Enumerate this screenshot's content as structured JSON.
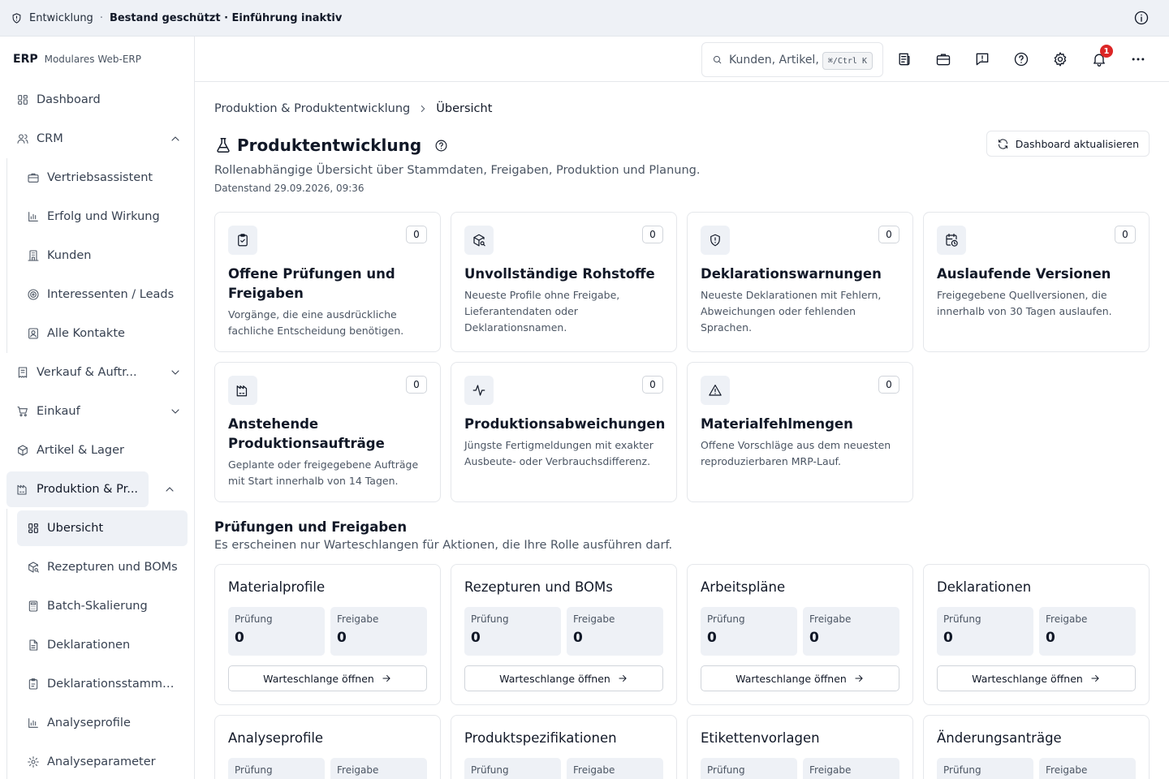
{
  "topbar": {
    "environment": "Entwicklung",
    "separator": "·",
    "status": "Bestand geschützt · Einführung inaktiv"
  },
  "brand": {
    "name": "ERP",
    "subtitle": "Modulares Web-ERP"
  },
  "sidebar": {
    "items": [
      {
        "label": "Dashboard",
        "icon": "dashboard-icon"
      },
      {
        "label": "CRM",
        "icon": "users-icon",
        "expanded": true
      },
      {
        "label": "Vertriebsassistent",
        "icon": "briefcase-icon"
      },
      {
        "label": "Erfolg und Wirkung",
        "icon": "bar-chart-icon"
      },
      {
        "label": "Kunden",
        "icon": "building-icon"
      },
      {
        "label": "Interessenten / Leads",
        "icon": "target-icon"
      },
      {
        "label": "Alle Kontakte",
        "icon": "contact-icon"
      },
      {
        "label": "Verkauf & Auftr...",
        "icon": "receipt-icon",
        "expanded": false
      },
      {
        "label": "Einkauf",
        "icon": "cart-icon",
        "expanded": false
      },
      {
        "label": "Artikel & Lager",
        "icon": "package-icon"
      },
      {
        "label": "Produktion & Pr...",
        "icon": "factory-icon",
        "expanded": true
      },
      {
        "label": "Übersicht",
        "icon": "dashboard-icon",
        "active": true
      },
      {
        "label": "Rezepturen und BOMs",
        "icon": "package-search-icon"
      },
      {
        "label": "Batch-Skalierung",
        "icon": "calculator-icon"
      },
      {
        "label": "Deklarationen",
        "icon": "document-icon"
      },
      {
        "label": "Deklarationsstammdaten",
        "icon": "clipboard-icon"
      },
      {
        "label": "Analyseprofile",
        "icon": "bar-chart-icon"
      },
      {
        "label": "Analyseparameter",
        "icon": "gear-icon"
      }
    ]
  },
  "header": {
    "search_placeholder": "Kunden, Artikel, Aufträge…",
    "shortcut": "⌘/Ctrl K",
    "notification_count": "1"
  },
  "breadcrumb": {
    "parent": "Produktion & Produktentwicklung",
    "current": "Übersicht"
  },
  "page": {
    "title": "Produktentwicklung",
    "refresh_label": "Dashboard aktualisieren",
    "description": "Rollenabhängige Übersicht über Stammdaten, Freigaben, Produktion und Planung.",
    "timestamp": "Datenstand 29.09.2026, 09:36"
  },
  "kpis": [
    {
      "icon": "clipboard-check-icon",
      "count": "0",
      "title": "Offene Prüfungen und Freigaben",
      "description": "Vorgänge, die eine ausdrückliche fachliche Entscheidung benötigen."
    },
    {
      "icon": "package-search-icon",
      "count": "0",
      "title": "Unvollständige Rohstoffe",
      "description": "Neueste Profile ohne Freigabe, Lieferantendaten oder Deklarationsnamen."
    },
    {
      "icon": "shield-alert-icon",
      "count": "0",
      "title": "Deklarationswarnungen",
      "description": "Neueste Deklarationen mit Fehlern, Abweichungen oder fehlenden Sprachen."
    },
    {
      "icon": "calendar-clock-icon",
      "count": "0",
      "title": "Auslaufende Versionen",
      "description": "Freigegebene Quellversionen, die innerhalb von 30 Tagen auslaufen."
    },
    {
      "icon": "factory-icon",
      "count": "0",
      "title": "Anstehende Produktionsaufträge",
      "description": "Geplante oder freigegebene Aufträge mit Start innerhalb von 14 Tagen."
    },
    {
      "icon": "activity-icon",
      "count": "0",
      "title": "Produktionsabweichungen",
      "description": "Jüngste Fertigmeldungen mit exakter Ausbeute- oder Verbrauchsdifferenz."
    },
    {
      "icon": "warning-triangle-icon",
      "count": "0",
      "title": "Materialfehlmengen",
      "description": "Offene Vorschläge aus dem neuesten reproduzierbaren MRP-Lauf."
    }
  ],
  "section": {
    "title": "Prüfungen und Freigaben",
    "description": "Es erscheinen nur Warteschlangen für Aktionen, die Ihre Rolle ausführen darf."
  },
  "queues": [
    {
      "title": "Materialprofile",
      "review_label": "Prüfung",
      "review": "0",
      "release_label": "Freigabe",
      "release": "0",
      "button": "Warteschlange öffnen"
    },
    {
      "title": "Rezepturen und BOMs",
      "review_label": "Prüfung",
      "review": "0",
      "release_label": "Freigabe",
      "release": "0",
      "button": "Warteschlange öffnen"
    },
    {
      "title": "Arbeitspläne",
      "review_label": "Prüfung",
      "review": "0",
      "release_label": "Freigabe",
      "release": "0",
      "button": "Warteschlange öffnen"
    },
    {
      "title": "Deklarationen",
      "review_label": "Prüfung",
      "review": "0",
      "release_label": "Freigabe",
      "release": "0",
      "button": "Warteschlange öffnen"
    },
    {
      "title": "Analyseprofile",
      "review_label": "Prüfung",
      "release_label": "Freigabe"
    },
    {
      "title": "Produktspezifikationen",
      "review_label": "Prüfung",
      "release_label": "Freigabe"
    },
    {
      "title": "Etikettenvorlagen",
      "review_label": "Prüfung",
      "release_label": "Freigabe"
    },
    {
      "title": "Änderungsanträge",
      "review_label": "Prüfung",
      "release_label": "Freigabe"
    }
  ]
}
